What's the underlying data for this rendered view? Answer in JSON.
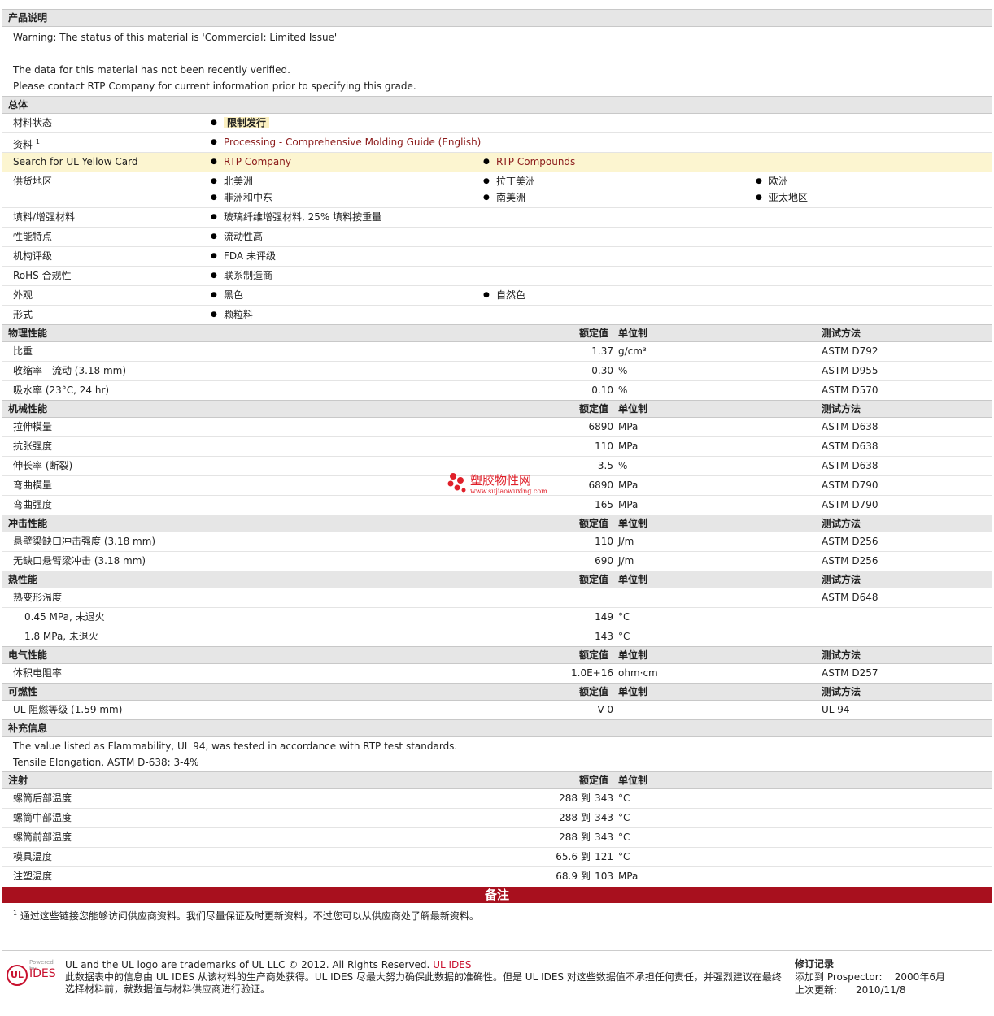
{
  "product_desc": {
    "title": "产品说明",
    "lines": [
      "Warning: The status of this material is 'Commercial: Limited Issue'",
      "",
      "The data for this material has not been recently verified.",
      "Please contact RTP Company for current information prior to specifying this grade."
    ]
  },
  "general": {
    "title": "总体",
    "status_label": "材料状态",
    "status_value": "限制发行",
    "resource_label": "资料",
    "resource_sup": "1",
    "resource_link": "Processing - Comprehensive Molding Guide (English)",
    "ul_label": "Search for UL Yellow Card",
    "ul_link1": "RTP Company",
    "ul_link2": "RTP Compounds",
    "region_label": "供货地区",
    "regions": [
      "北美洲",
      "拉丁美洲",
      "欧洲",
      "非洲和中东",
      "南美洲",
      "亚太地区"
    ],
    "filler_label": "填料/增强材料",
    "filler_value": "玻璃纤维增强材料, 25% 填料按重量",
    "feature_label": "性能特点",
    "feature_value": "流动性高",
    "agency_label": "机构评级",
    "agency_value": "FDA 未评级",
    "rohs_label": "RoHS 合规性",
    "rohs_value": "联系制造商",
    "appearance_label": "外观",
    "appearance_values": [
      "黑色",
      "自然色"
    ],
    "form_label": "形式",
    "form_value": "颗粒料"
  },
  "headers": {
    "nominal": "额定值",
    "unit": "单位制",
    "method": "测试方法"
  },
  "physical": {
    "title": "物理性能",
    "rows": [
      {
        "name": "比重",
        "value": "1.37",
        "unit": "g/cm³",
        "method": "ASTM D792"
      },
      {
        "name": "收缩率 - 流动  (3.18 mm)",
        "value": "0.30",
        "unit": "%",
        "method": "ASTM D955"
      },
      {
        "name": "吸水率  (23°C, 24 hr)",
        "value": "0.10",
        "unit": "%",
        "method": "ASTM D570"
      }
    ]
  },
  "mechanical": {
    "title": "机械性能",
    "rows": [
      {
        "name": "拉伸模量",
        "value": "6890",
        "unit": "MPa",
        "method": "ASTM D638"
      },
      {
        "name": "抗张强度",
        "value": "110",
        "unit": "MPa",
        "method": "ASTM D638"
      },
      {
        "name": "伸长率  (断裂)",
        "value": "3.5",
        "unit": "%",
        "method": "ASTM D638"
      },
      {
        "name": "弯曲模量",
        "value": "6890",
        "unit": "MPa",
        "method": "ASTM D790"
      },
      {
        "name": "弯曲强度",
        "value": "165",
        "unit": "MPa",
        "method": "ASTM D790"
      }
    ]
  },
  "watermark": {
    "text": "塑胶物性网",
    "url": "www.sujiaowuxing.com"
  },
  "impact": {
    "title": "冲击性能",
    "rows": [
      {
        "name": "悬壁梁缺口冲击强度  (3.18 mm)",
        "value": "110",
        "unit": "J/m",
        "method": "ASTM D256"
      },
      {
        "name": "无缺口悬臂梁冲击  (3.18 mm)",
        "value": "690",
        "unit": "J/m",
        "method": "ASTM D256"
      }
    ]
  },
  "thermal": {
    "title": "热性能",
    "parent": {
      "name": "热变形温度",
      "method": "ASTM D648"
    },
    "rows": [
      {
        "name": "0.45 MPa, 未退火",
        "value": "149",
        "unit": "°C"
      },
      {
        "name": "1.8 MPa, 未退火",
        "value": "143",
        "unit": "°C"
      }
    ]
  },
  "electrical": {
    "title": "电气性能",
    "rows": [
      {
        "name": "体积电阻率",
        "value": "1.0E+16",
        "unit": "ohm·cm",
        "method": "ASTM D257"
      }
    ]
  },
  "flammability": {
    "title": "可燃性",
    "rows": [
      {
        "name": "UL 阻燃等级  (1.59 mm)",
        "value": "V-0",
        "unit": "",
        "method": "UL 94"
      }
    ]
  },
  "supplement": {
    "title": "补充信息",
    "lines": [
      "The value listed as Flammability, UL 94, was tested in accordance with RTP test standards.",
      "Tensile Elongation, ASTM D-638: 3-4%"
    ]
  },
  "injection": {
    "title": "注射",
    "to": "到",
    "rows": [
      {
        "name": "螺筒后部温度",
        "min": "288",
        "max": "343",
        "unit": "°C"
      },
      {
        "name": "螺筒中部温度",
        "min": "288",
        "max": "343",
        "unit": "°C"
      },
      {
        "name": "螺筒前部温度",
        "min": "288",
        "max": "343",
        "unit": "°C"
      },
      {
        "name": "模具温度",
        "min": "65.6",
        "max": "121",
        "unit": "°C"
      },
      {
        "name": "注塑温度",
        "min": "68.9",
        "max": "103",
        "unit": "MPa"
      }
    ]
  },
  "notes": {
    "title": "备注",
    "sup": "1",
    "text": "通过这些链接您能够访问供应商资料。我们尽量保证及时更新资料，不过您可以从供应商处了解最新资料。"
  },
  "footer": {
    "powered": "Powered by",
    "logo_ul": "UL",
    "logo_ides": "IDES",
    "trademark": "UL and the UL logo are trademarks of UL LLC © 2012. All Rights Reserved.",
    "trademark_link": "UL IDES",
    "disclaimer": "此数据表中的信息由  UL IDES 从该材料的生产商处获得。UL IDES 尽最大努力确保此数据的准确性。但是  UL IDES 对这些数据值不承担任何责任，并强烈建议在最终选择材料前，就数据值与材料供应商进行验证。",
    "rev_title": "修订记录",
    "added_label": "添加到  Prospector:",
    "added_value": "2000年6月",
    "updated_label": "上次更新:",
    "updated_value": "2010/11/8"
  }
}
